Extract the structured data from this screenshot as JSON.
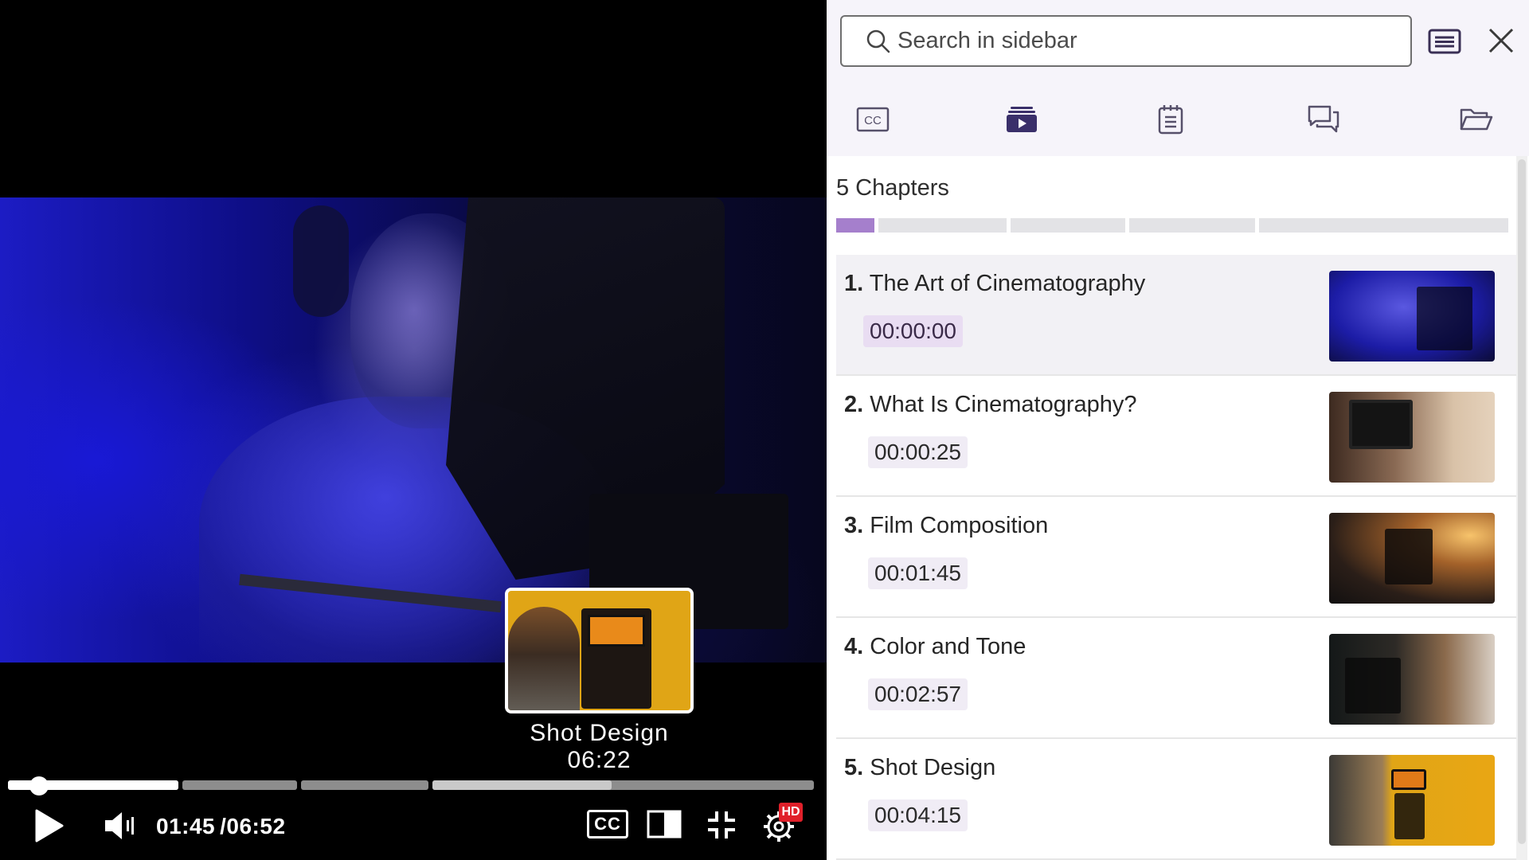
{
  "player": {
    "current_time": "01:45",
    "total_time": "/06:52",
    "progress_fraction": 0.255,
    "hd_badge": "HD",
    "cc_label": "CC",
    "preview": {
      "title": "Shot Design",
      "time": "06:22"
    }
  },
  "sidebar": {
    "search_placeholder": "Search in sidebar",
    "tabs": [
      "captions",
      "chapters",
      "notes",
      "comments",
      "files"
    ],
    "tab_cc_label": "CC",
    "active_tab": "chapters",
    "chapters_heading": "5 Chapters",
    "accent_color": "#a57fcc",
    "chapters": [
      {
        "number": "1.",
        "title": "The Art of Cinematography",
        "time": "00:00:00",
        "active": true
      },
      {
        "number": "2.",
        "title": "What Is Cinematography?",
        "time": "00:00:25",
        "active": false
      },
      {
        "number": "3.",
        "title": "Film Composition",
        "time": "00:01:45",
        "active": false
      },
      {
        "number": "4.",
        "title": "Color and Tone",
        "time": "00:02:57",
        "active": false
      },
      {
        "number": "5.",
        "title": "Shot Design",
        "time": "00:04:15",
        "active": false
      }
    ]
  }
}
